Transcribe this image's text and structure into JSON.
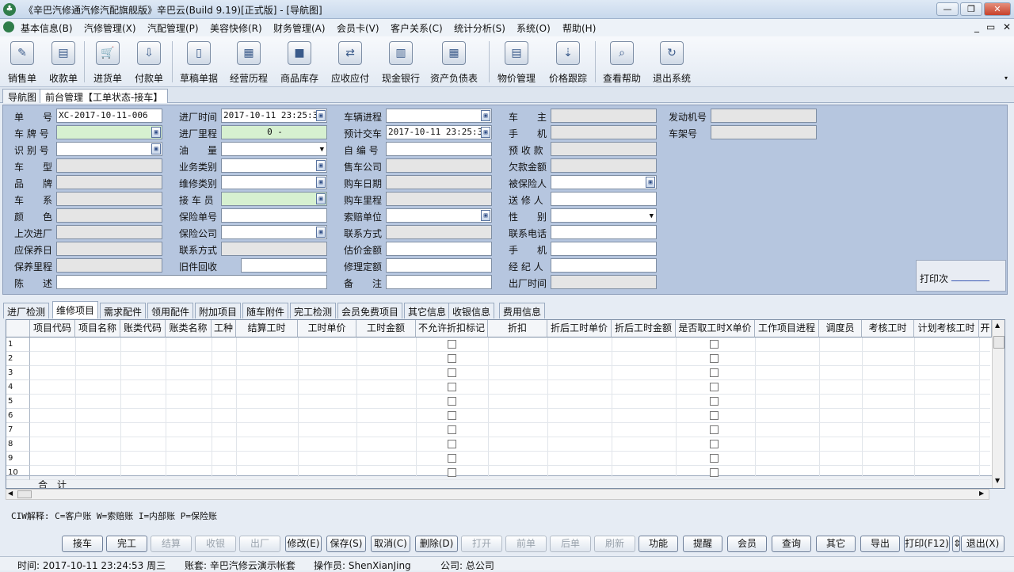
{
  "window": {
    "title": "《辛巴汽修通汽修汽配旗舰版》辛巴云(Build 9.19)[正式版] - [导航图]",
    "minimize": "—",
    "restore": "❐",
    "close": "✕"
  },
  "menu": [
    "基本信息(B)",
    "汽修管理(X)",
    "汽配管理(P)",
    "美容快修(R)",
    "财务管理(A)",
    "会员卡(V)",
    "客户关系(C)",
    "统计分析(S)",
    "系统(O)",
    "帮助(H)"
  ],
  "mdi": [
    "_",
    "▭",
    "✕"
  ],
  "toolbar": [
    {
      "label": "销售单",
      "icon": "sales-order-icon",
      "glyph": "✎"
    },
    {
      "label": "收款单",
      "icon": "receipt-icon",
      "glyph": "▤"
    },
    {
      "label": "进货单",
      "icon": "cart-icon",
      "glyph": "🛒"
    },
    {
      "label": "付款单",
      "icon": "download-icon",
      "glyph": "⇩"
    },
    {
      "label": "草稿单据",
      "icon": "draft-icon",
      "glyph": "▯"
    },
    {
      "label": "经营历程",
      "icon": "film-icon",
      "glyph": "▦"
    },
    {
      "label": "商品库存",
      "icon": "box-icon",
      "glyph": "■"
    },
    {
      "label": "应收应付",
      "icon": "exchange-icon",
      "glyph": "⇄"
    },
    {
      "label": "现金银行",
      "icon": "bank-chart-icon",
      "glyph": "▥"
    },
    {
      "label": "资产负债表",
      "icon": "calendar-icon",
      "glyph": "▦"
    },
    {
      "label": "物价管理",
      "icon": "price-doc-icon",
      "glyph": "▤"
    },
    {
      "label": "价格跟踪",
      "icon": "price-track-icon",
      "glyph": "⇣"
    },
    {
      "label": "查看帮助",
      "icon": "magnifier-icon",
      "glyph": "⌕"
    },
    {
      "label": "退出系统",
      "icon": "exit-icon",
      "glyph": "↻"
    }
  ],
  "tabs": [
    "导航图",
    "前台管理【工单状态-接车】"
  ],
  "form": {
    "col1": [
      {
        "label": "单　　号",
        "value": "XC-2017-10-11-006",
        "style": "w"
      },
      {
        "label": "车 牌 号",
        "value": "",
        "style": "g",
        "pick": true
      },
      {
        "label": "识 别 号",
        "value": "",
        "style": "w",
        "pick": true
      },
      {
        "label": "车　　型",
        "value": "",
        "style": ""
      },
      {
        "label": "品　　牌",
        "value": "",
        "style": ""
      },
      {
        "label": "车　　系",
        "value": "",
        "style": ""
      },
      {
        "label": "颜　　色",
        "value": "",
        "style": ""
      },
      {
        "label": "上次进厂",
        "value": "",
        "style": ""
      },
      {
        "label": "应保养日",
        "value": "",
        "style": ""
      },
      {
        "label": "保养里程",
        "value": "",
        "style": ""
      }
    ],
    "col2": [
      {
        "label": "进厂时间",
        "value": "2017-10-11 23:25:36",
        "style": "w",
        "pick": true
      },
      {
        "label": "进厂里程",
        "value": "0 -",
        "style": "g c"
      },
      {
        "label": "油　　量",
        "value": "",
        "style": "w",
        "dd": true
      },
      {
        "label": "业务类别",
        "value": "",
        "style": "w",
        "pick": true
      },
      {
        "label": "维修类别",
        "value": "",
        "style": "w",
        "pick": true
      },
      {
        "label": "接 车 员",
        "value": "",
        "style": "g",
        "pick": true
      },
      {
        "label": "保险单号",
        "value": "",
        "style": "w"
      },
      {
        "label": "保险公司",
        "value": "",
        "style": "w",
        "pick": true
      },
      {
        "label": "联系方式",
        "value": "",
        "style": ""
      }
    ],
    "old_recycle_label": "旧件回收",
    "col3": [
      {
        "label": "车辆进程",
        "value": "",
        "style": "w",
        "pick": true
      },
      {
        "label": "预计交车",
        "value": "2017-10-11 23:25:36",
        "style": "w",
        "pick": true
      },
      {
        "label": "自 编 号",
        "value": "",
        "style": "w"
      },
      {
        "label": "售车公司",
        "value": "",
        "style": ""
      },
      {
        "label": "购车日期",
        "value": "",
        "style": ""
      },
      {
        "label": "购车里程",
        "value": "",
        "style": ""
      },
      {
        "label": "索赔单位",
        "value": "",
        "style": "w",
        "pick": true
      },
      {
        "label": "联系方式",
        "value": "",
        "style": ""
      },
      {
        "label": "估价金额",
        "value": "",
        "style": "w"
      },
      {
        "label": "修理定额",
        "value": "",
        "style": "w"
      },
      {
        "label": "备　　注",
        "value": "",
        "style": "w"
      }
    ],
    "col4": [
      {
        "label": "车　　主",
        "value": "",
        "style": ""
      },
      {
        "label": "手　　机",
        "value": "",
        "style": ""
      },
      {
        "label": "预 收 款",
        "value": "",
        "style": ""
      },
      {
        "label": "欠款金额",
        "value": "",
        "style": ""
      },
      {
        "label": "被保险人",
        "value": "",
        "style": "w",
        "pick": true
      },
      {
        "label": "送 修 人",
        "value": "",
        "style": "w"
      },
      {
        "label": "性　　别",
        "value": "",
        "style": "w",
        "dd": true
      },
      {
        "label": "联系电话",
        "value": "",
        "style": "w"
      },
      {
        "label": "手　　机",
        "value": "",
        "style": "w"
      },
      {
        "label": "经 纪 人",
        "value": "",
        "style": "w"
      },
      {
        "label": "出厂时间",
        "value": "",
        "style": ""
      }
    ],
    "col5": [
      {
        "label": "发动机号",
        "value": "",
        "style": ""
      },
      {
        "label": "车架号",
        "value": "",
        "style": ""
      }
    ],
    "desc_label": "陈　　述",
    "print_label": "打印次",
    "print_value": "________"
  },
  "subtabs": [
    "进厂检测",
    "维修项目",
    "需求配件",
    "领用配件",
    "附加项目",
    "随车附件",
    "完工检测",
    "会员免费项目",
    "其它信息",
    "收银信息",
    "费用信息"
  ],
  "grid": {
    "columns": [
      "项目代码",
      "项目名称",
      "账类代码",
      "账类名称",
      "工种",
      "结算工时",
      "工时单价",
      "工时金额",
      "不允许折扣标记",
      "折扣",
      "折后工时单价",
      "折后工时金额",
      "是否取工时X单价",
      "工作项目进程",
      "调度员",
      "考核工时",
      "计划考核工时",
      "开"
    ],
    "rows": [
      "1",
      "2",
      "3",
      "4",
      "5",
      "6",
      "7",
      "8",
      "9",
      "10"
    ],
    "total_label": "合　计"
  },
  "hint": "CIW解释: C=客户账 W=索赔账 I=内部账 P=保险账",
  "buttons": [
    {
      "label": "接车",
      "enabled": true
    },
    {
      "label": "完工",
      "enabled": true
    },
    {
      "label": "结算",
      "enabled": false
    },
    {
      "label": "收银",
      "enabled": false
    },
    {
      "label": "出厂",
      "enabled": false
    },
    {
      "label": "修改(E)",
      "enabled": true
    },
    {
      "label": "保存(S)",
      "enabled": true
    },
    {
      "label": "取消(C)",
      "enabled": true
    },
    {
      "label": "删除(D)",
      "enabled": true
    },
    {
      "label": "打开",
      "enabled": false
    },
    {
      "label": "前单",
      "enabled": false
    },
    {
      "label": "后单",
      "enabled": false
    },
    {
      "label": "刷新",
      "enabled": false
    },
    {
      "label": "功能",
      "enabled": true
    },
    {
      "label": "提醒",
      "enabled": true
    },
    {
      "label": "会员",
      "enabled": true
    },
    {
      "label": "查询",
      "enabled": true
    },
    {
      "label": "其它",
      "enabled": true
    },
    {
      "label": "导出",
      "enabled": true
    },
    {
      "label": "打印(F12)",
      "enabled": true
    },
    {
      "label": "⇕",
      "enabled": true
    },
    {
      "label": "退出(X)",
      "enabled": true
    }
  ],
  "status": {
    "time": "时间: 2017-10-11 23:24:53 周三",
    "account": "账套: 辛巴汽修云演示帐套",
    "operator": "操作员: ShenXianJing",
    "company": "公司: 总公司"
  }
}
